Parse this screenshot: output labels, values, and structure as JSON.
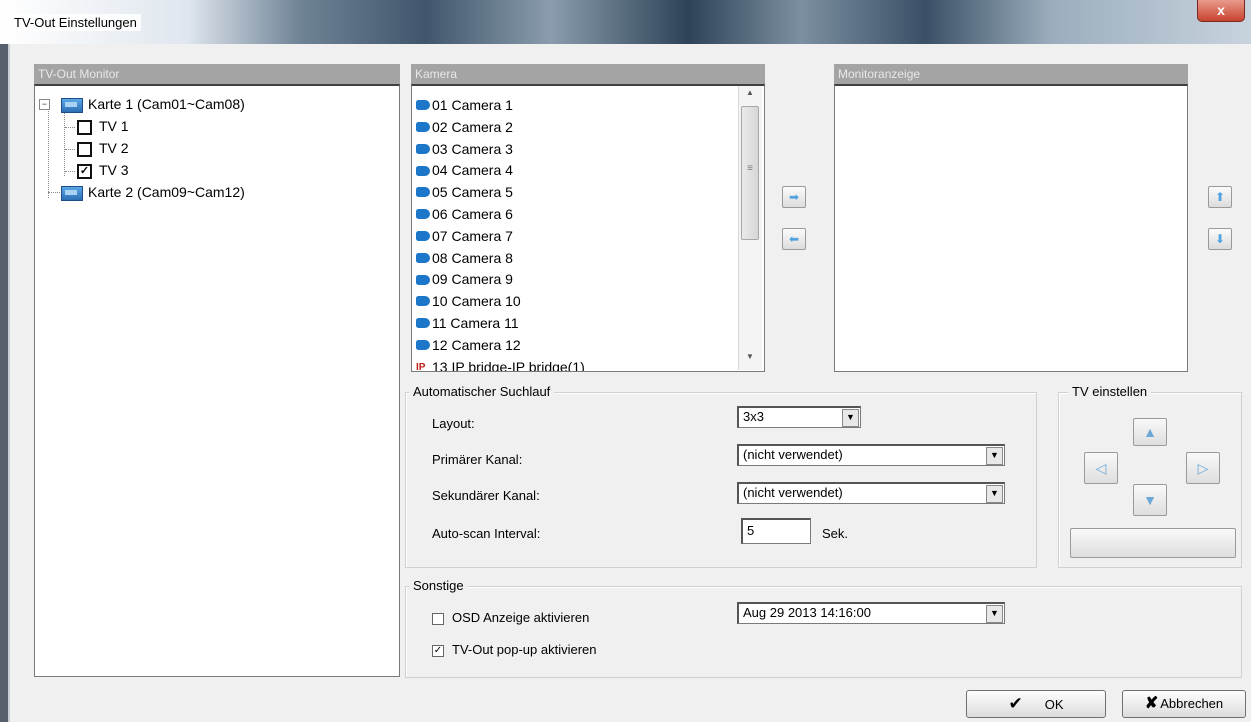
{
  "window": {
    "title": "TV-Out Einstellungen",
    "close_label": "x"
  },
  "tv_out_monitor": {
    "header": "TV-Out Monitor",
    "cards": [
      {
        "label": "Karte 1 (Cam01~Cam08)",
        "expanded": true,
        "tvs": [
          {
            "label": "TV 1",
            "checked": false
          },
          {
            "label": "TV 2",
            "checked": false
          },
          {
            "label": "TV 3",
            "checked": true
          }
        ]
      },
      {
        "label": "Karte 2 (Cam09~Cam12)",
        "expanded": false
      }
    ],
    "expander_symbol": "−",
    "check_symbol": "✓"
  },
  "kamera": {
    "header": "Kamera",
    "items": [
      {
        "label": "01 Camera 1",
        "icon": "camera-icon"
      },
      {
        "label": "02 Camera 2",
        "icon": "camera-icon"
      },
      {
        "label": "03 Camera 3",
        "icon": "camera-icon"
      },
      {
        "label": "04 Camera 4",
        "icon": "camera-icon"
      },
      {
        "label": "05 Camera 5",
        "icon": "camera-icon"
      },
      {
        "label": "06 Camera 6",
        "icon": "camera-icon"
      },
      {
        "label": "07 Camera 7",
        "icon": "camera-icon"
      },
      {
        "label": "08 Camera 8",
        "icon": "camera-icon"
      },
      {
        "label": "09 Camera 9",
        "icon": "camera-icon"
      },
      {
        "label": "10 Camera 10",
        "icon": "camera-icon"
      },
      {
        "label": "11 Camera 11",
        "icon": "camera-icon"
      },
      {
        "label": "12 Camera 12",
        "icon": "camera-icon"
      },
      {
        "label": "13 IP bridge-IP bridge(1)",
        "icon": "ip-icon"
      }
    ],
    "ip_icon_text": "IP",
    "scroll_up": "▲",
    "scroll_down": "▼",
    "scroll_grip": "≡"
  },
  "transfer": {
    "add_symbol": "➡",
    "remove_symbol": "⬅"
  },
  "monitoranzeige": {
    "header": "Monitoranzeige",
    "up_symbol": "⬆",
    "down_symbol": "⬇"
  },
  "auto_scan": {
    "title": "Automatischer Suchlauf",
    "layout_label": "Layout:",
    "layout_value": "3x3",
    "primary_label": "Primärer Kanal:",
    "primary_value": "(nicht verwendet)",
    "secondary_label": "Sekundärer Kanal:",
    "secondary_value": "(nicht verwendet)",
    "interval_label": "Auto-scan Interval:",
    "interval_value": "5",
    "interval_unit": "Sek.",
    "dropdown_symbol": "▼"
  },
  "tv_setup": {
    "title": "TV einstellen",
    "up": "▲",
    "down": "▼",
    "left": "◁",
    "right": "▷"
  },
  "other": {
    "title": "Sonstige",
    "osd_label": "OSD Anzeige aktivieren",
    "osd_checked": false,
    "datetime_value": "Aug 29 2013 14:16:00",
    "popup_label": "TV-Out pop-up aktivieren",
    "popup_checked": true,
    "check_symbol": "✓"
  },
  "buttons": {
    "ok_label": "OK",
    "ok_icon": "✔",
    "cancel_label": "Abbrechen",
    "cancel_icon": "✘"
  }
}
